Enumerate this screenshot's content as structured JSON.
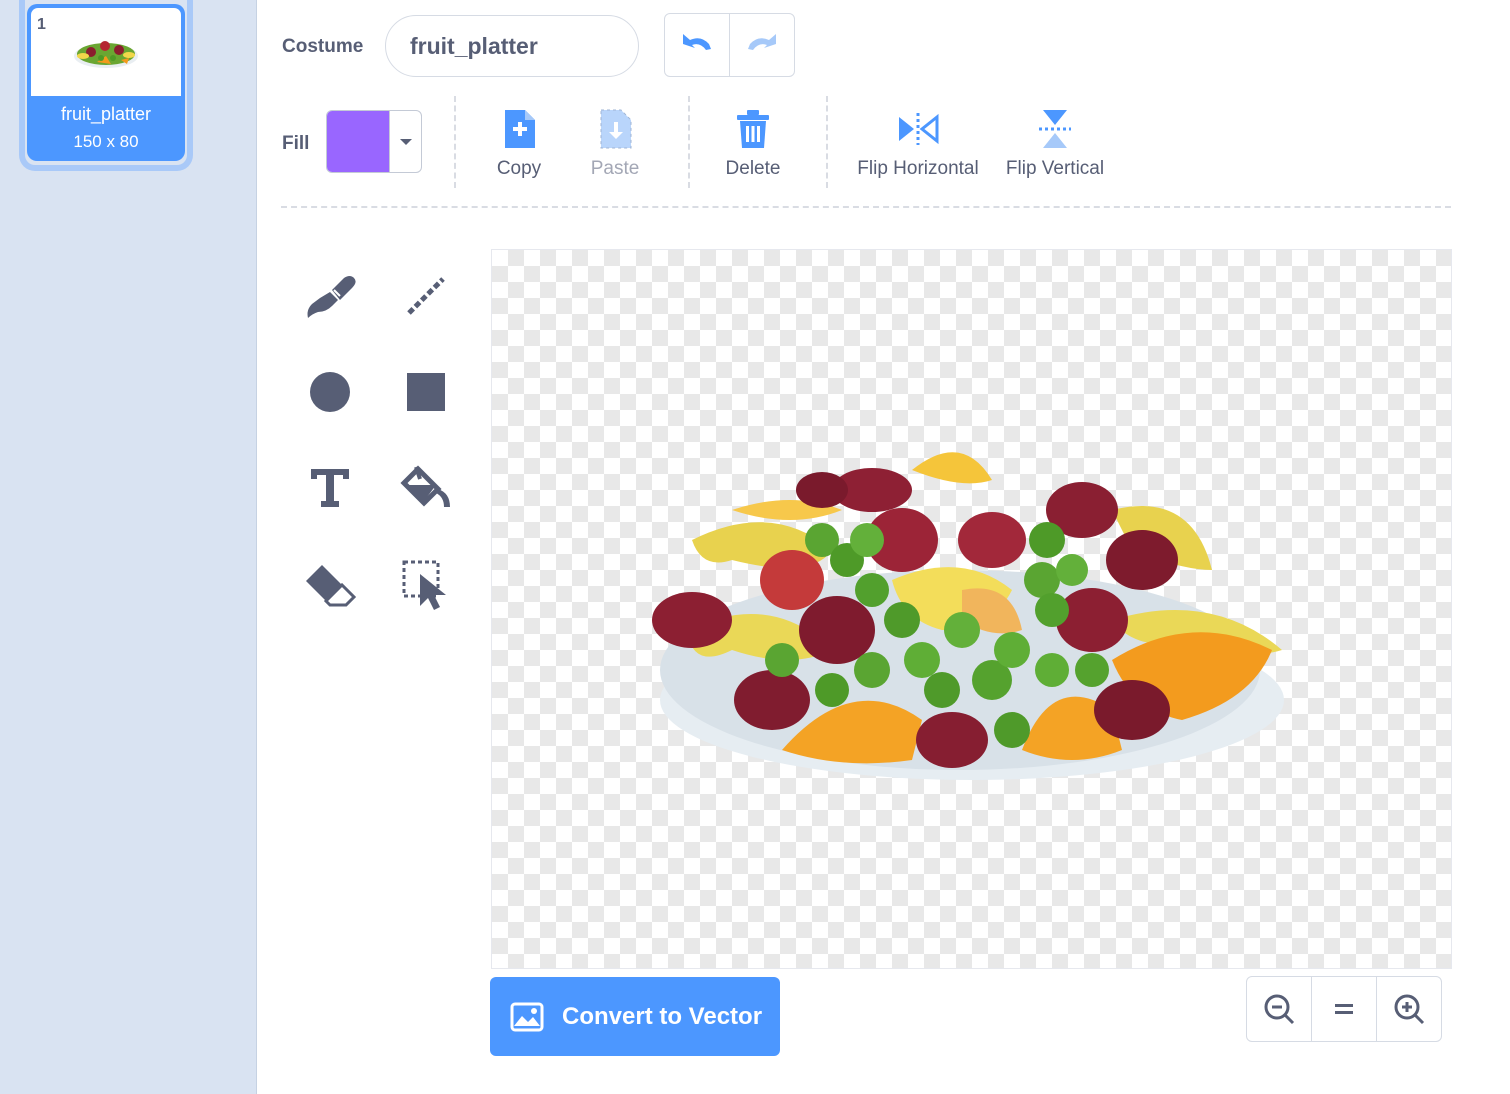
{
  "sidebar": {
    "costume": {
      "number": "1",
      "name": "fruit_platter",
      "size": "150 x 80"
    }
  },
  "editor": {
    "costume_label": "Costume",
    "costume_name": "fruit_platter",
    "fill_label": "Fill",
    "fill_color": "#9966ff",
    "accent_color": "#4c97ff",
    "actions": {
      "copy": "Copy",
      "paste": "Paste",
      "delete": "Delete",
      "flip_horizontal": "Flip Horizontal",
      "flip_vertical": "Flip Vertical"
    },
    "tools": [
      "brush-icon",
      "line-icon",
      "circle-icon",
      "rectangle-icon",
      "text-icon",
      "fill-bucket-icon",
      "eraser-icon",
      "select-icon"
    ],
    "convert_button": "Convert to Vector",
    "zoom": [
      "zoom-out-icon",
      "zoom-reset-icon",
      "zoom-in-icon"
    ]
  }
}
